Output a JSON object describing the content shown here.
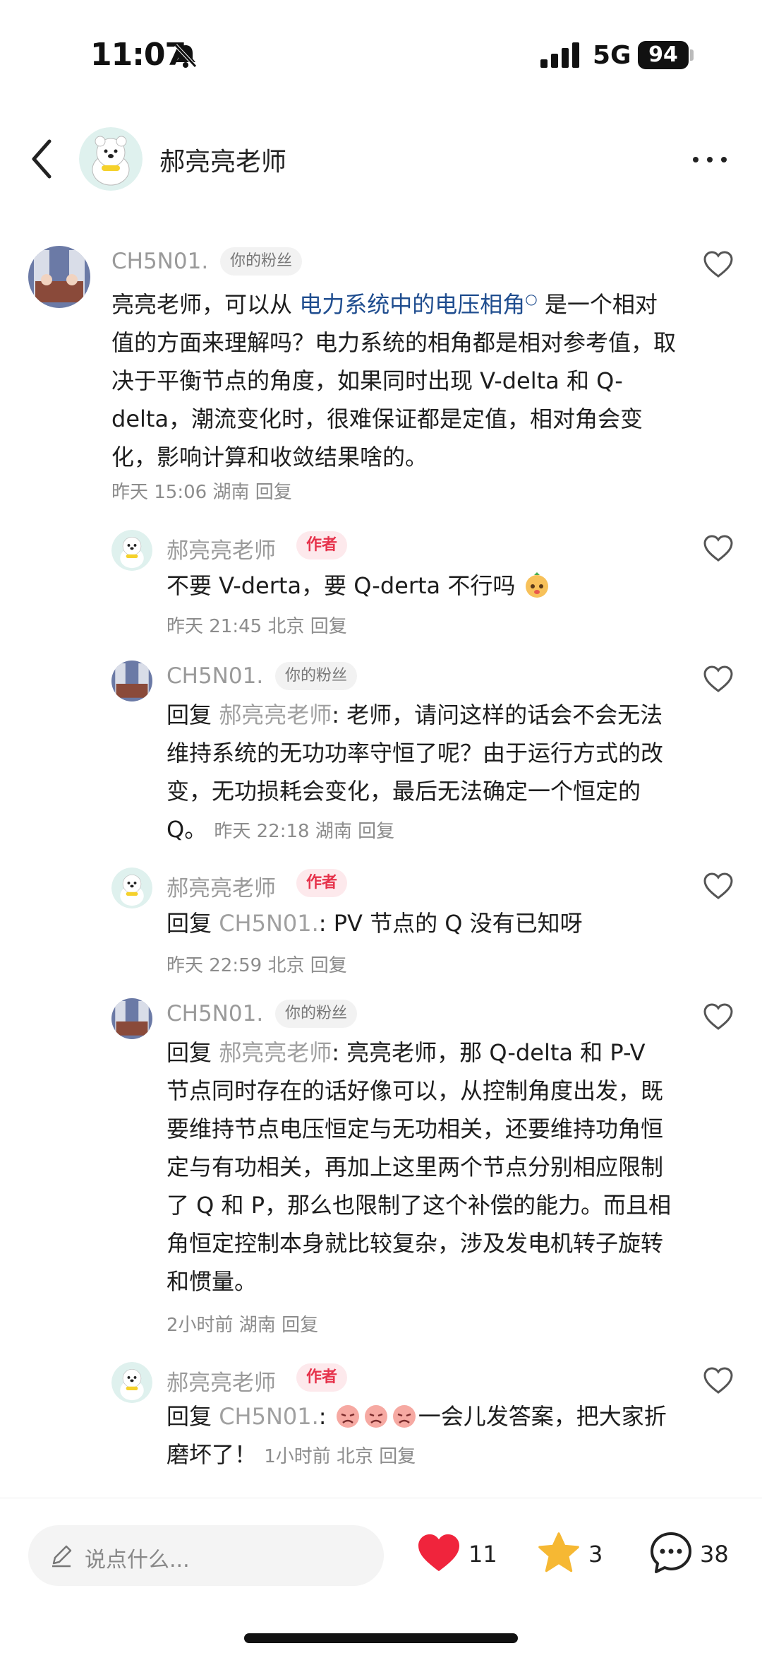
{
  "status": {
    "time": "11:07",
    "network": "5G",
    "battery": "94"
  },
  "header": {
    "title": "郝亮亮老师"
  },
  "comments": [
    {
      "name": "CH5N01.",
      "badge": "你的粉丝",
      "text_before_link": "亮亮老师，可以从 ",
      "link": "电力系统中的电压相角",
      "text_after_link": " 是一个相对值的方面来理解吗？电力系统的相角都是相对参考值，取决于平衡节点的角度，如果同时出现 V-delta 和 Q-delta，潮流变化时，很难保证都是定值，相对角会变化，影响计算和收敛结果啥的。",
      "meta": "昨天 15:06 湖南 回复"
    },
    {
      "name": "郝亮亮老师",
      "badge": "作者",
      "text": "不要 V-derta，要 Q-derta 不行吗",
      "meta": "昨天 21:45 北京 回复"
    },
    {
      "name": "CH5N01.",
      "badge": "你的粉丝",
      "reply_prefix": "回复 ",
      "reply_to": "郝亮亮老师",
      "text": ": 老师，请问这样的话会不会无法维持系统的无功功率守恒了呢？由于运行方式的改变，无功损耗会变化，最后无法确定一个恒定的 Q。",
      "meta": "昨天 22:18 湖南 回复"
    },
    {
      "name": "郝亮亮老师",
      "badge": "作者",
      "reply_prefix": "回复 ",
      "reply_to": "CH5N01.",
      "text": ": PV 节点的 Q 没有已知呀",
      "meta": "昨天 22:59 北京 回复"
    },
    {
      "name": "CH5N01.",
      "badge": "你的粉丝",
      "reply_prefix": "回复 ",
      "reply_to": "郝亮亮老师",
      "text": ": 亮亮老师，那 Q-delta 和 P-V 节点同时存在的话好像可以，从控制角度出发，既要维持节点电压恒定与无功相关，还要维持功角恒定与有功相关，再加上这里两个节点分别相应限制了 Q 和 P，那么也限制了这个补偿的能力。而且相角恒定控制本身就比较复杂，涉及发电机转子旋转和惯量。",
      "meta": "2小时前 湖南 回复"
    },
    {
      "name": "郝亮亮老师",
      "badge": "作者",
      "reply_prefix": "回复 ",
      "reply_to": "CH5N01.",
      "text_after_emoji": "一会儿发答案，把大家折磨坏了！",
      "meta": "1小时前 北京 回复"
    }
  ],
  "bottom": {
    "placeholder": "说点什么...",
    "likes": "11",
    "stars": "3",
    "comments": "38",
    "like_color": "#f0243c",
    "star_color": "#f6b833"
  }
}
